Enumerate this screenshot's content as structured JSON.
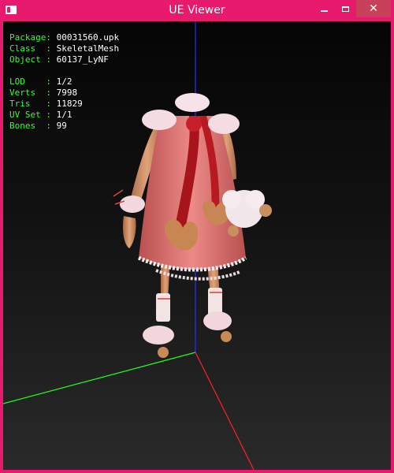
{
  "window": {
    "title": "UE Viewer"
  },
  "info": [
    {
      "label": "Package",
      "value": "00031560.upk"
    },
    {
      "label": "Class  ",
      "value": "SkeletalMesh"
    },
    {
      "label": "Object ",
      "value": "60137_LyNF"
    },
    {
      "label": "LOD    ",
      "value": "1/2"
    },
    {
      "label": "Verts  ",
      "value": "7998"
    },
    {
      "label": "Tris   ",
      "value": "11829"
    },
    {
      "label": "UV Set ",
      "value": "1/1"
    },
    {
      "label": "Bones  ",
      "value": "99"
    }
  ],
  "colors": {
    "frame": "#e81a6e",
    "label_text": "#33ff33",
    "value_text": "#ffffff",
    "axis_x": "#ff2222",
    "axis_y": "#22ff22",
    "axis_z": "#2233ff"
  },
  "icons": {
    "app": "app-window-icon",
    "minimize": "minimize-icon",
    "maximize": "maximize-icon",
    "close": "close-icon"
  }
}
